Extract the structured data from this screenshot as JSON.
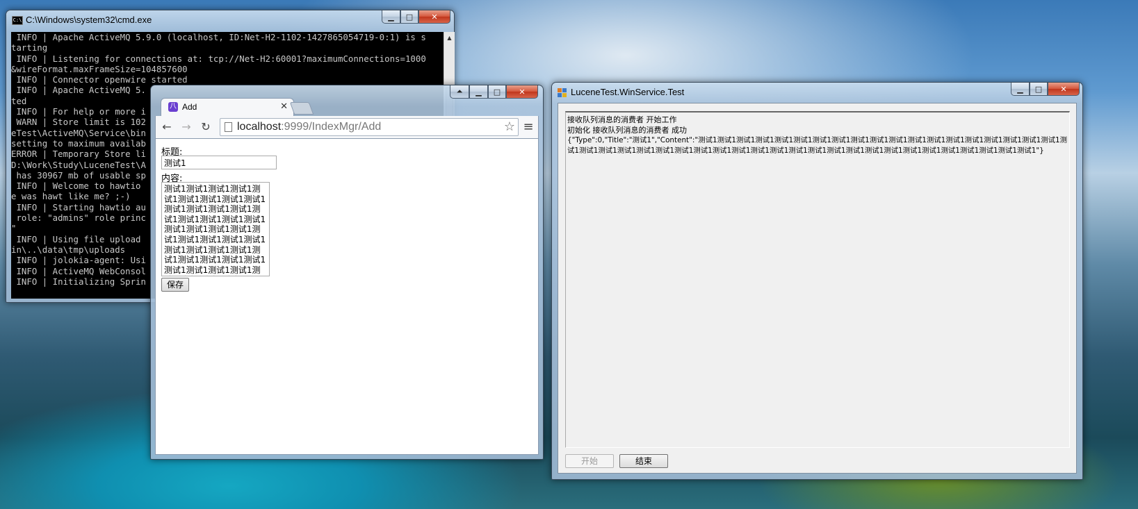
{
  "cmd": {
    "title": "C:\\Windows\\system32\\cmd.exe",
    "lines": [
      " INFO | Apache ActiveMQ 5.9.0 (localhost, ID:Net-H2-1102-1427865054719-0:1) is s",
      "tarting",
      " INFO | Listening for connections at: tcp://Net-H2:60001?maximumConnections=1000",
      "&wireFormat.maxFrameSize=104857600",
      " INFO | Connector openwire started",
      " INFO | Apache ActiveMQ 5.",
      "ted",
      " INFO | For help or more i",
      " WARN | Store limit is 102",
      "eTest\\ActiveMQ\\Service\\bin",
      "setting to maximum availab",
      "ERROR | Temporary Store li",
      "D:\\Work\\Study\\LuceneTest\\A",
      " has 30967 mb of usable sp",
      " INFO | Welcome to hawtio ",
      "e was hawt like me? ;-)",
      " INFO | Starting hawtio au",
      " role: \"admins\" role princ",
      "\"",
      " INFO | Using file upload ",
      "in\\..\\data\\tmp\\uploads",
      " INFO | jolokia-agent: Usi",
      " INFO | ActiveMQ WebConsol",
      " INFO | Initializing Sprin"
    ]
  },
  "browser": {
    "tab_title": "Add",
    "favicon_glyph": "八",
    "url_host": "localhost",
    "url_path": ":9999/IndexMgr/Add",
    "title_label": "标题:",
    "title_value": "测试1",
    "content_label": "内容:",
    "content_value": "测试1测试1测试1测试1测试1测试1测试1测试1测试1测试1测试1测试1测试1测试1测试1测试1测试1测试1测试1测试1测试1测试1测试1测试1测试1测试1测试1测试1测试1测试1测试1测试1测试1测试1测试1测试1测试1测试1测试1测试1测试1测试1测试1测试1",
    "save_label": "保存"
  },
  "winform": {
    "title": "LuceneTest.WinService.Test",
    "log_line1": "接收队列消息的消费者 开始工作",
    "log_line2": "初始化 接收队列消息的消费者 成功",
    "log_json": "{\"Type\":0,\"Title\":\"测试1\",\"Content\":\"测试1测试1测试1测试1测试1测试1测试1测试1测试1测试1测试1测试1测试1测试1测试1测试1测试1测试1测试1测试1测试1测试1测试1测试1测试1测试1测试1测试1测试1测试1测试1测试1测试1测试1测试1测试1测试1测试1测试1测试1测试1测试1测试1测试1\"}",
    "start_label": "开始",
    "stop_label": "结束"
  },
  "icons": {
    "min": "minimize-icon",
    "max": "maximize-icon",
    "close": "close-icon"
  }
}
